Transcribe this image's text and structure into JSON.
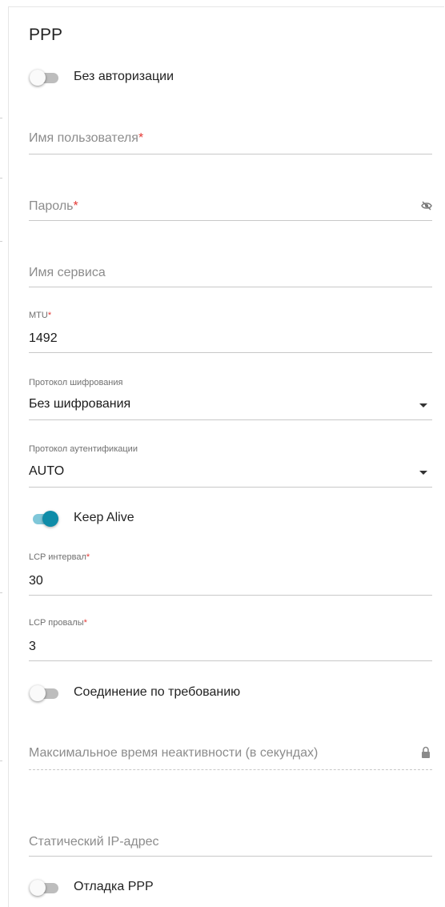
{
  "section": {
    "title": "PPP"
  },
  "toggles": {
    "no_auth": {
      "label": "Без авторизации",
      "on": false
    },
    "keep_alive": {
      "label": "Keep Alive",
      "on": true
    },
    "on_demand": {
      "label": "Соединение по требованию",
      "on": false
    },
    "debug": {
      "label": "Отладка PPP",
      "on": false
    }
  },
  "fields": {
    "username": {
      "placeholder": "Имя пользователя",
      "required": "*",
      "value": ""
    },
    "password": {
      "placeholder": "Пароль",
      "required": "*",
      "value": ""
    },
    "service": {
      "placeholder": "Имя сервиса",
      "value": ""
    },
    "mtu": {
      "label": "MTU",
      "required": "*",
      "value": "1492"
    },
    "encryption": {
      "label": "Протокол шифрования",
      "value": "Без шифрования"
    },
    "auth_protocol": {
      "label": "Протокол аутентификации",
      "value": "AUTO"
    },
    "lcp_interval": {
      "label": "LCP интервал",
      "required": "*",
      "value": "30"
    },
    "lcp_failures": {
      "label": "LCP провалы",
      "required": "*",
      "value": "3"
    },
    "idle_time": {
      "placeholder": "Максимальное время неактивности (в секундах)",
      "value": ""
    },
    "static_ip": {
      "placeholder": "Статический IP-адрес",
      "value": ""
    }
  },
  "icons": {
    "password_visibility": "eye-off-icon",
    "idle_lock": "lock-icon",
    "dropdown": "caret-down-icon"
  },
  "colors": {
    "accent": "#0f8ca8",
    "accent_track": "#7fc7d9",
    "required": "#e53935"
  }
}
